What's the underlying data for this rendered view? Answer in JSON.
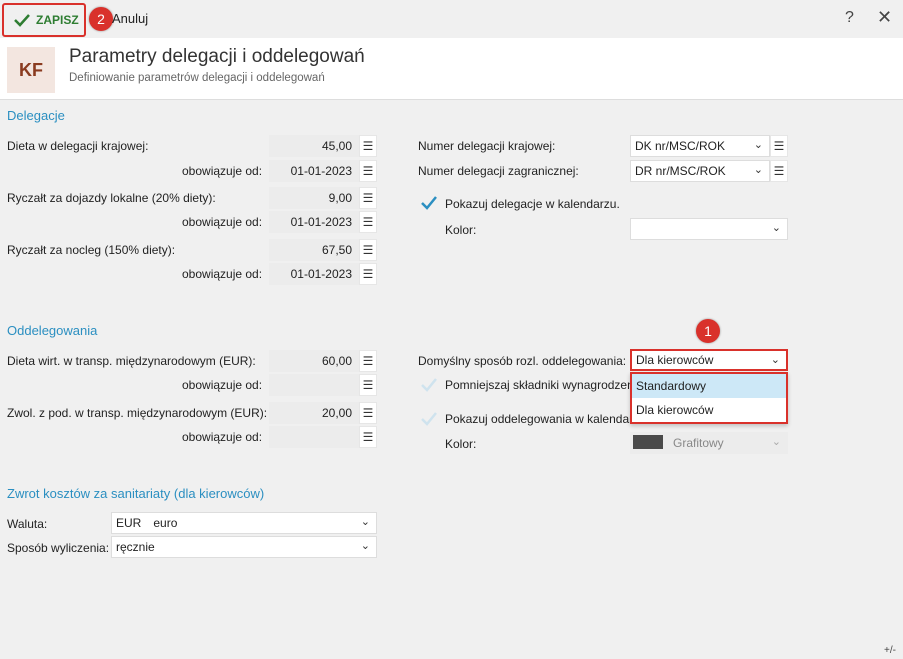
{
  "toolbar": {
    "save_label": "ZAPISZ",
    "cancel_label": "Anuluj",
    "help_label": "?",
    "close_label": "✕",
    "marker_1": "1",
    "marker_2": "2"
  },
  "header": {
    "avatar": "KF",
    "title": "Parametry delegacji i oddelegowań",
    "subtitle": "Definiowanie parametrów delegacji i oddelegowań"
  },
  "delegacje": {
    "section_title": "Delegacje",
    "dieta_kraj_label": "Dieta w delegacji krajowej:",
    "dieta_kraj_value": "45,00",
    "obowiazuje_label": "obowiązuje od:",
    "dieta_kraj_date": "01-01-2023",
    "ryczalt_dojazdy_label": "Ryczałt za dojazdy lokalne (20% diety):",
    "ryczalt_dojazdy_value": "9,00",
    "ryczalt_dojazdy_date": "01-01-2023",
    "ryczalt_nocleg_label": "Ryczałt za nocleg (150% diety):",
    "ryczalt_nocleg_value": "67,50",
    "ryczalt_nocleg_date": "01-01-2023",
    "numer_kraj_label": "Numer delegacji krajowej:",
    "numer_kraj_value": "DK nr/MSC/ROK",
    "numer_zagr_label": "Numer delegacji zagranicznej:",
    "numer_zagr_value": "DR nr/MSC/ROK",
    "pokazuj_label": "Pokazuj delegacje w kalendarzu.",
    "kolor_label": "Kolor:"
  },
  "oddelegowania": {
    "section_title": "Oddelegowania",
    "dieta_wirt_label": "Dieta wirt. w transp. międzynarodowym (EUR):",
    "dieta_wirt_value": "60,00",
    "obowiazuje_label": "obowiązuje od:",
    "zwol_label": "Zwol. z pod. w transp. międzynarodowym (EUR):",
    "zwol_value": "20,00",
    "domyslny_label": "Domyślny sposób rozl. oddelegowania:",
    "domyslny_value": "Dla kierowców",
    "pomniejszaj_label": "Pomniejszaj składniki wynagrodzen",
    "pokazuj_label": "Pokazuj oddelegowania w kalendar",
    "kolor_label": "Kolor:",
    "kolor_value": "Grafitowy",
    "dropdown_options": [
      "Standardowy",
      "Dla kierowców"
    ]
  },
  "zwrot": {
    "section_title": "Zwrot kosztów za sanitariaty (dla kierowców)",
    "waluta_label": "Waluta:",
    "waluta_code": "EUR",
    "waluta_name": "euro",
    "sposob_label": "Sposób wyliczenia:",
    "sposob_value": "ręcznie"
  },
  "footer": {
    "plusminus": "+/-"
  },
  "colors": {
    "accent": "#2b8fc1",
    "highlight": "#d9312b",
    "save_green": "#2e7d32"
  }
}
